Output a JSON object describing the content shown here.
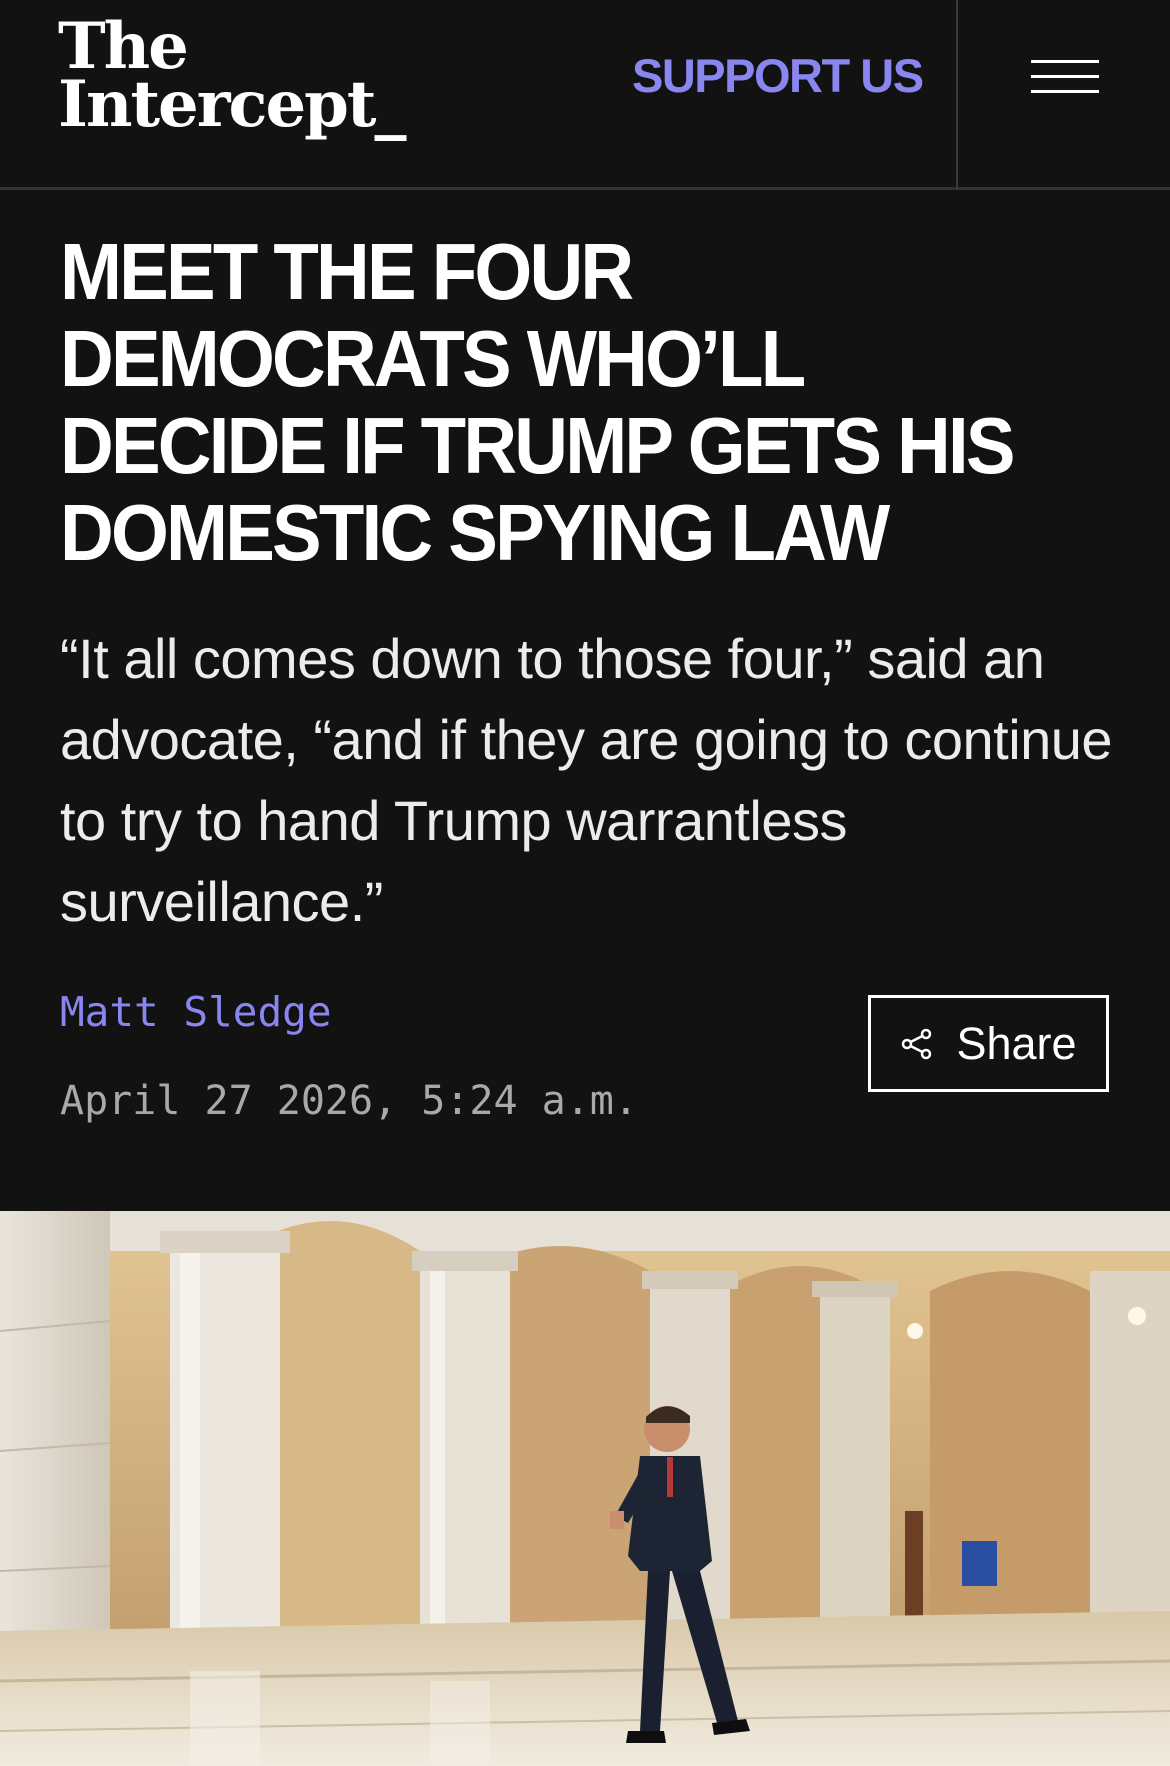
{
  "header": {
    "logo_line1": "The",
    "logo_line2": "Intercept_",
    "support_label": "SUPPORT US",
    "menu_icon": "hamburger-menu-icon"
  },
  "article": {
    "headline": "MEET THE FOUR DEMOCRATS WHO’LL DECIDE IF TRUMP GETS HIS DOMESTIC SPYING LAW",
    "dek": "“It all comes down to those four,” said an advocate, “and if they are going to continue to try to hand Trump warrantless surveillance.”",
    "author": "Matt Sledge",
    "date": "April 27 2026, 5:24 a.m.",
    "share_label": "Share",
    "share_icon": "share-icon"
  },
  "colors": {
    "background": "#121213",
    "accent": "#8a86ef",
    "date_text": "#a9a9ab"
  }
}
